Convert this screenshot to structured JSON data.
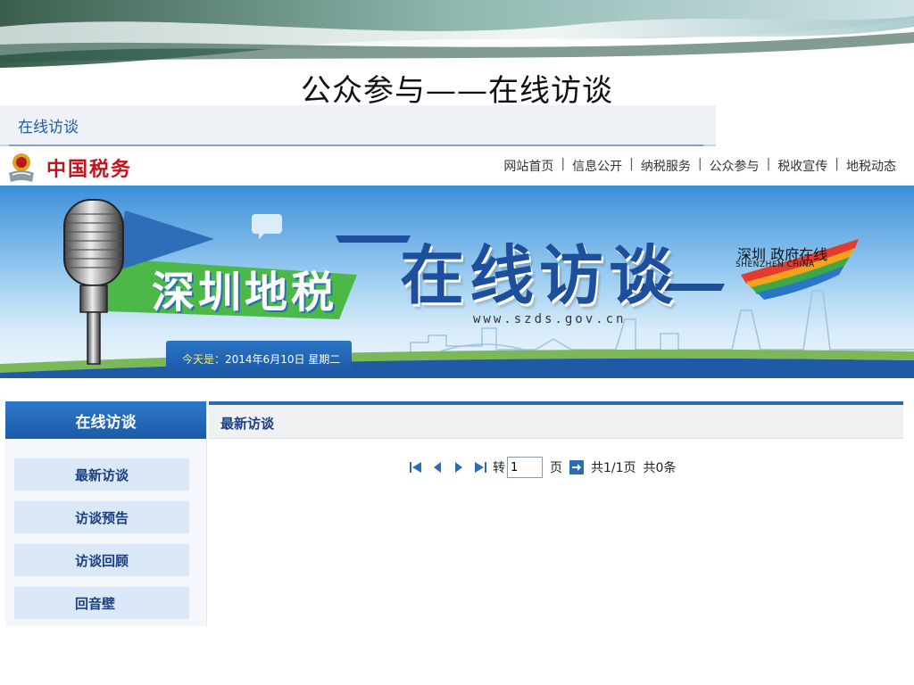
{
  "slide": {
    "title": "公众参与——在线访谈"
  },
  "tabbar": {
    "active_tab": "在线访谈"
  },
  "header": {
    "logo_text": "中国税务",
    "nav": [
      "网站首页",
      "信息公开",
      "纳税服务",
      "公众参与",
      "税收宣传",
      "地税动态"
    ],
    "nav_separator": "|"
  },
  "banner": {
    "brand": "深圳地税",
    "headline": "在线访谈",
    "url": "www.szds.gov.cn",
    "shenzhen_cn": "深圳 政府在线",
    "shenzhen_en": "SHENZHEN CHINA",
    "today_label": "今天是：",
    "today_value": "2014年6月10日 星期二"
  },
  "sidebar": {
    "title": "在线访谈",
    "items": [
      "最新访谈",
      "访谈预告",
      "访谈回顾",
      "回音壁"
    ]
  },
  "main": {
    "panel_title": "最新访谈",
    "pager": {
      "goto_label": "转",
      "page_value": "1",
      "page_unit": "页",
      "total_pages": "共1/1页",
      "total_items": "共0条"
    }
  },
  "colors": {
    "accent": "#2b6cb5",
    "headline": "#1d4f9c",
    "logo": "#c0141b",
    "sidebar_item_bg": "#dbe8f8"
  }
}
